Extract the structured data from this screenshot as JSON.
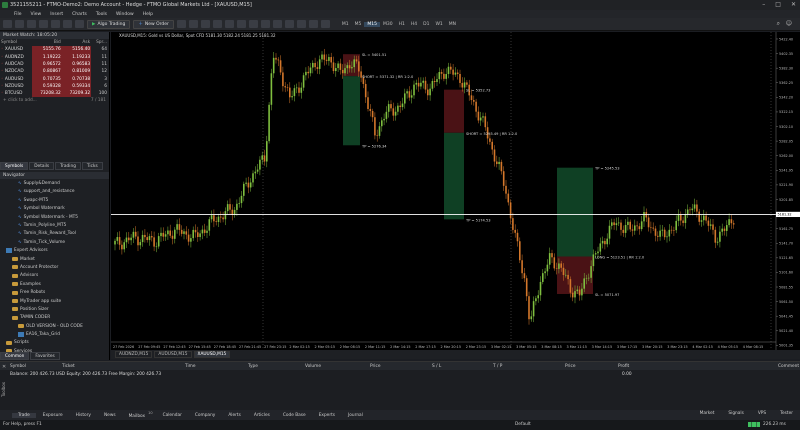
{
  "window": {
    "title": "3521155211 - FTMO-Demo2: Demo Account - Hedge - FTMO Global Markets Ltd - [XAUUSD,M15]"
  },
  "menu": [
    "File",
    "View",
    "Insert",
    "Charts",
    "Tools",
    "Window",
    "Help"
  ],
  "toolbar": {
    "algo_label": "Algo Trading",
    "new_order_label": "New Order",
    "timeframes": [
      "M1",
      "M5",
      "M15",
      "M30",
      "H1",
      "H4",
      "D1",
      "W1",
      "MN"
    ],
    "active_timeframe": "M15"
  },
  "market_watch": {
    "title": "Market Watch: 18:05:20",
    "columns": [
      "Symbol",
      "Bid",
      "Ask",
      "Spr..."
    ],
    "rows": [
      {
        "symbol": "XAUUSD",
        "bid": "5155.76",
        "ask": "5156.40",
        "spread": "64"
      },
      {
        "symbol": "AUDNZD",
        "bid": "1.19222",
        "ask": "1.19233",
        "spread": "11"
      },
      {
        "symbol": "AUDCAD",
        "bid": "0.96572",
        "ask": "0.96583",
        "spread": "11"
      },
      {
        "symbol": "NZDCAD",
        "bid": "0.80867",
        "ask": "0.81009",
        "spread": "12"
      },
      {
        "symbol": "AUDUSD",
        "bid": "0.70735",
        "ask": "0.70738",
        "spread": "3"
      },
      {
        "symbol": "NZDUSD",
        "bid": "0.59328",
        "ask": "0.59334",
        "spread": "6"
      },
      {
        "symbol": "BTCUSD",
        "bid": "73208.32",
        "ask": "73209.32",
        "spread": "100"
      }
    ],
    "add_text": "+ click to add...",
    "count": "7 / 181",
    "tabs": [
      "Symbols",
      "Details",
      "Trading",
      "Ticks"
    ]
  },
  "navigator": {
    "title": "Navigator",
    "items": [
      {
        "label": "Supply&Demand",
        "kind": "indicator",
        "indent": 3
      },
      {
        "label": "support_and_resistance",
        "kind": "indicator",
        "indent": 3
      },
      {
        "label": "Swapc-MT5",
        "kind": "indicator",
        "indent": 3
      },
      {
        "label": "Symbol Watermark",
        "kind": "indicator",
        "indent": 3
      },
      {
        "label": "Symbol Watermark - MT5",
        "kind": "indicator",
        "indent": 3
      },
      {
        "label": "Tamin_Polyline_MT5",
        "kind": "indicator",
        "indent": 3
      },
      {
        "label": "Tamin_Risk_Reward_Tool",
        "kind": "indicator",
        "indent": 3
      },
      {
        "label": "Tamin_Tick_Volume",
        "kind": "indicator",
        "indent": 3
      },
      {
        "label": "Expert Advisors",
        "kind": "ea",
        "indent": 1
      },
      {
        "label": "Market",
        "kind": "folder",
        "indent": 2
      },
      {
        "label": "Account Protector",
        "kind": "folder",
        "indent": 2
      },
      {
        "label": "Advisors",
        "kind": "folder",
        "indent": 2
      },
      {
        "label": "Examples",
        "kind": "folder",
        "indent": 2
      },
      {
        "label": "Free Robots",
        "kind": "folder",
        "indent": 2
      },
      {
        "label": "MyTrader app suite",
        "kind": "folder",
        "indent": 2
      },
      {
        "label": "Position Sizer",
        "kind": "folder",
        "indent": 2
      },
      {
        "label": "TAMIN CODER",
        "kind": "folder",
        "indent": 2
      },
      {
        "label": "OLD VERSION - OLD CODE",
        "kind": "folder",
        "indent": 3
      },
      {
        "label": "EA16_Taka_Grid",
        "kind": "ea",
        "indent": 3
      },
      {
        "label": "Scripts",
        "kind": "folder",
        "indent": 1
      },
      {
        "label": "Services",
        "kind": "folder",
        "indent": 1
      }
    ],
    "tabs": [
      "Common",
      "Favorites"
    ]
  },
  "chart": {
    "info": "XAUUSD,M15:  Gold vs US Dollar, Spot CFD  5181.30 5182.24 5181.25 5181.32",
    "symbol": "XAUUSD",
    "timeframe": "M15",
    "price_labels": [
      "5422.40",
      "5402.35",
      "5382.30",
      "5362.25",
      "5342.20",
      "5322.15",
      "5302.10",
      "5282.05",
      "5262.00",
      "5241.95",
      "5221.90",
      "5201.85",
      "5181.80",
      "5161.75",
      "5141.70",
      "5121.65",
      "5101.60",
      "5081.55",
      "5061.50",
      "5041.45",
      "5021.40",
      "5001.35"
    ],
    "current_price": "5181.32",
    "time_labels": [
      "27 Feb 2026",
      "27 Feb 09:45",
      "27 Feb 12:45",
      "27 Feb 15:45",
      "27 Feb 18:45",
      "27 Feb 21:45",
      "27 Feb 23:15",
      "2 Mar 02:15",
      "2 Mar 05:15",
      "2 Mar 08:15",
      "2 Mar 11:15",
      "2 Mar 14:15",
      "2 Mar 17:15",
      "2 Mar 20:15",
      "2 Mar 23:15",
      "3 Mar 02:15",
      "3 Mar 05:15",
      "3 Mar 08:15",
      "3 Mar 11:15",
      "3 Mar 14:15",
      "3 Mar 17:15",
      "3 Mar 20:15",
      "3 Mar 23:15",
      "4 Mar 02:15",
      "4 Mar 05:15",
      "4 Mar 08:15"
    ],
    "trades": [
      {
        "sl": "SL = 5401.51",
        "entry": "SHORT = 5371.32 | RR 1:2.0",
        "tp": "TP = 5276.34"
      },
      {
        "sl": "SL = 5352.73",
        "entry": "SHORT = 5293.49 | RR 1:2.0",
        "tp": "TP = 5174.53"
      },
      {
        "tp": "TP = 5245.53",
        "entry": "LONG = 5123.51 | RR 1:2.0",
        "sl": "SL = 5071.97"
      }
    ],
    "tabs": [
      "AUDNZD,M15",
      "AUDUSD,M15",
      "XAUUSD,M15"
    ],
    "active_tab": "XAUUSD,M15",
    "colors": {
      "bull": "#7fbf3f",
      "bear": "#d4772b",
      "tp_zone": "#0f4024",
      "sl_zone": "#4a1215"
    }
  },
  "toolbox": {
    "columns": [
      "Symbol",
      "Ticket",
      "Time",
      "Type",
      "Volume",
      "Price",
      "S / L",
      "T / P",
      "Price",
      "Profit",
      "Comment"
    ],
    "balance_line": "Balance: 200 426.73 USD  Equity: 200 426.73  Free Margin: 200 426.73",
    "profit": "0.00",
    "tabs": [
      "Trade",
      "Exposure",
      "History",
      "News",
      "Mailbox",
      "Calendar",
      "Company",
      "Alerts",
      "Articles",
      "Code Base",
      "Experts",
      "Journal"
    ],
    "badge": "10",
    "right_items": [
      "Market",
      "Signals",
      "VPS",
      "Tester"
    ],
    "side_label": "Toolbox"
  },
  "status": {
    "help": "For Help, press F1",
    "profile": "Default",
    "ping": "226.23 ms"
  }
}
